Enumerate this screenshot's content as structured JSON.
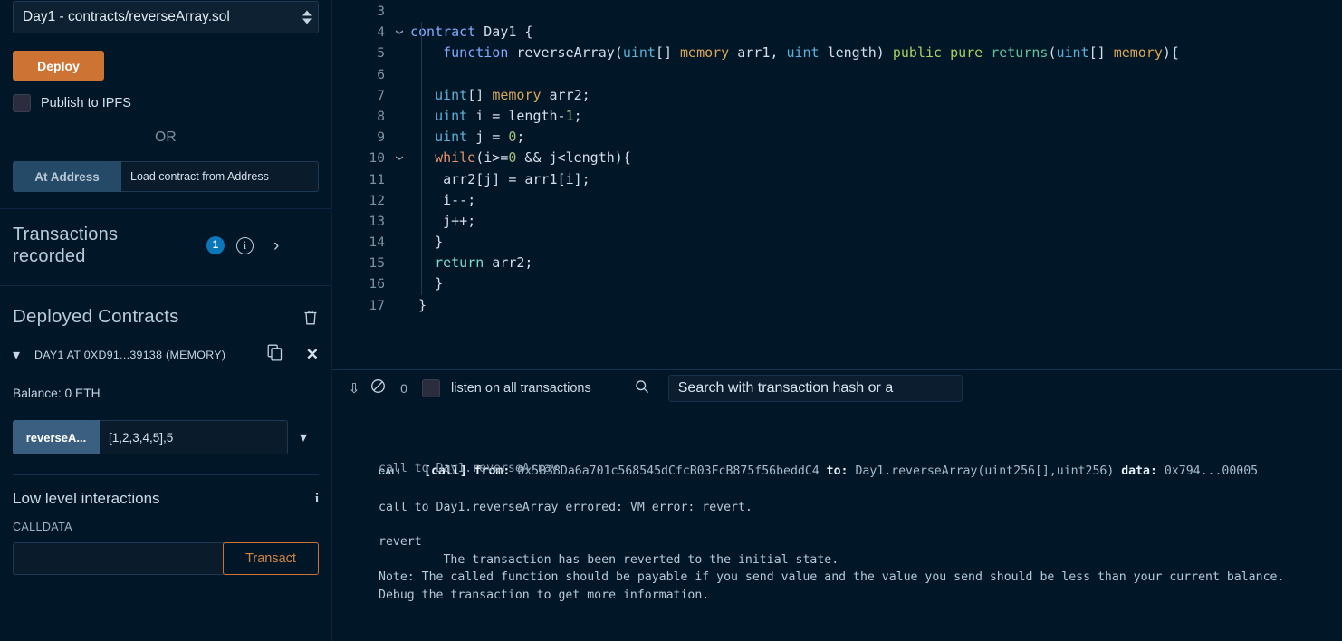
{
  "app": "Remix IDE - Deploy & Run Transactions",
  "left_panel": {
    "contract_select": {
      "value": "Day1 - contracts/reverseArray.sol",
      "icon": "spinner-arrows-icon"
    },
    "deploy_button": "Deploy",
    "publish_ipfs": {
      "label": "Publish to IPFS",
      "checked": false
    },
    "or_label": "OR",
    "at_address": {
      "button": "At Address",
      "input_value": "",
      "placeholder": "Load contract from Address"
    },
    "transactions_recorded": {
      "title": "Transactions recorded",
      "count": "1",
      "info_icon": "info-circle-icon",
      "expand_icon": "chevron-right-icon"
    },
    "deployed_contracts": {
      "title": "Deployed Contracts",
      "clear_icon": "trash-icon",
      "instance": {
        "caret_icon": "chevron-down-icon",
        "label": "DAY1 AT 0XD91...39138 (MEMORY)",
        "copy_icon": "copy-icon",
        "close_icon": "close-icon",
        "balance": "Balance: 0 ETH",
        "function_button": "reverseA...",
        "function_input_value": "[1,2,3,4,5],5",
        "function_caret_icon": "chevron-down-icon"
      }
    },
    "low_level": {
      "title": "Low level interactions",
      "info_icon": "info-icon",
      "calldata_label": "CALLDATA",
      "calldata_value": "",
      "transact_button": "Transact"
    }
  },
  "editor": {
    "first_visible_line": 3,
    "lines": [
      {
        "n": "3",
        "fold": "",
        "tokens": []
      },
      {
        "n": "4",
        "fold": "v",
        "tokens": [
          [
            "t-contract",
            "contract"
          ],
          [
            "t-punc",
            " "
          ],
          [
            "t-name",
            "Day1"
          ],
          [
            "t-punc",
            " {"
          ]
        ]
      },
      {
        "n": "5",
        "fold": "",
        "tokens": [
          [
            "t-punc",
            "    "
          ],
          [
            "t-fn",
            "function"
          ],
          [
            "t-punc",
            " "
          ],
          [
            "t-name",
            "reverseArray"
          ],
          [
            "t-punc",
            "("
          ],
          [
            "t-type",
            "uint"
          ],
          [
            "t-punc",
            "[] "
          ],
          [
            "t-mem",
            "memory"
          ],
          [
            "t-punc",
            " arr1, "
          ],
          [
            "t-type",
            "uint"
          ],
          [
            "t-punc",
            " length"
          ],
          [
            "t-punc",
            ") "
          ],
          [
            "t-mod",
            "public"
          ],
          [
            "t-punc",
            " "
          ],
          [
            "t-mod",
            "pure"
          ],
          [
            "t-punc",
            " "
          ],
          [
            "t-returns",
            "returns"
          ],
          [
            "t-punc",
            "("
          ],
          [
            "t-type",
            "uint"
          ],
          [
            "t-punc",
            "[] "
          ],
          [
            "t-mem",
            "memory"
          ],
          [
            "t-punc",
            "){"
          ]
        ]
      },
      {
        "n": "6",
        "fold": "",
        "tokens": []
      },
      {
        "n": "7",
        "fold": "",
        "tokens": [
          [
            "t-punc",
            "   "
          ],
          [
            "t-type",
            "uint"
          ],
          [
            "t-punc",
            "[] "
          ],
          [
            "t-mem",
            "memory"
          ],
          [
            "t-punc",
            " arr2;"
          ]
        ]
      },
      {
        "n": "8",
        "fold": "",
        "tokens": [
          [
            "t-punc",
            "   "
          ],
          [
            "t-type",
            "uint"
          ],
          [
            "t-punc",
            " i = length-"
          ],
          [
            "t-num",
            "1"
          ],
          [
            "t-punc",
            ";"
          ]
        ]
      },
      {
        "n": "9",
        "fold": "",
        "tokens": [
          [
            "t-punc",
            "   "
          ],
          [
            "t-type",
            "uint"
          ],
          [
            "t-punc",
            " j = "
          ],
          [
            "t-num",
            "0"
          ],
          [
            "t-punc",
            ";"
          ]
        ]
      },
      {
        "n": "10",
        "fold": "v",
        "tokens": [
          [
            "t-punc",
            "   "
          ],
          [
            "t-ctrl",
            "while"
          ],
          [
            "t-punc",
            "(i>="
          ],
          [
            "t-num",
            "0"
          ],
          [
            "t-punc",
            " && j<length){"
          ]
        ]
      },
      {
        "n": "11",
        "fold": "",
        "tokens": [
          [
            "t-punc",
            "    arr2[j] = arr1[i];"
          ]
        ]
      },
      {
        "n": "12",
        "fold": "",
        "tokens": [
          [
            "t-punc",
            "    i--;"
          ]
        ]
      },
      {
        "n": "13",
        "fold": "",
        "tokens": [
          [
            "t-punc",
            "    j++;"
          ]
        ]
      },
      {
        "n": "14",
        "fold": "",
        "tokens": [
          [
            "t-punc",
            "   }"
          ]
        ]
      },
      {
        "n": "15",
        "fold": "",
        "tokens": [
          [
            "t-punc",
            "   "
          ],
          [
            "t-ret",
            "return"
          ],
          [
            "t-punc",
            " arr2;"
          ]
        ]
      },
      {
        "n": "16",
        "fold": "",
        "tokens": [
          [
            "t-punc",
            "   }"
          ]
        ]
      },
      {
        "n": "17",
        "fold": "",
        "tokens": [
          [
            "t-punc",
            " }"
          ]
        ]
      }
    ]
  },
  "terminal": {
    "toolbar": {
      "collapse_icon": "double-chevron-down-icon",
      "clear_icon": "ban-circle-icon",
      "pending_count": "0",
      "listen_checkbox_checked": false,
      "listen_label": "listen on all transactions",
      "search_icon": "search-icon",
      "search_value": "Search with transaction hash or a",
      "search_placeholder": "Search with transaction hash or address"
    },
    "clipped_line": "call to Day1.reverseArray",
    "call_entry": {
      "tag": "CALL",
      "label": "[call]",
      "from_key": "from:",
      "from_value": "0x5B38Da6a701c568545dCfcB03FcB875f56beddC4",
      "to_key": "to:",
      "to_value": "Day1.reverseArray(uint256[],uint256)",
      "data_key": "data:",
      "data_value": "0x794...00005"
    },
    "messages": [
      "call to Day1.reverseArray errored: VM error: revert.",
      "revert",
      "\t The transaction has been reverted to the initial state.",
      "Note: The called function should be payable if you send value and the value you send should be less than your current balance.",
      "Debug the transaction to get more information."
    ]
  },
  "colors": {
    "background": "#011627",
    "accent_orange": "#cd7434",
    "accent_blue": "#0b76b8",
    "button_blue": "#3a5f80",
    "text": "#d5e0ec"
  }
}
